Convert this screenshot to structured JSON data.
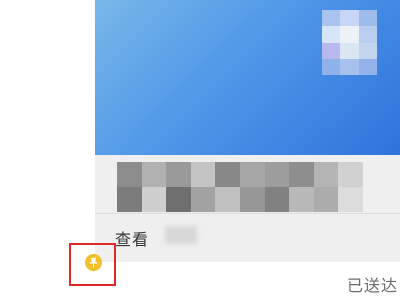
{
  "message_card": {
    "view_label": "查看"
  },
  "pin": {
    "icon": "pin-icon",
    "color": "#f1c12a",
    "highlight_color": "#e02828"
  },
  "status": {
    "delivered_label": "已送达"
  },
  "colors": {
    "banner_start": "#79b7e9",
    "banner_end": "#2f73db",
    "card_bg": "#efefef",
    "text": "#333333",
    "status_text": "#6b6b6b"
  }
}
